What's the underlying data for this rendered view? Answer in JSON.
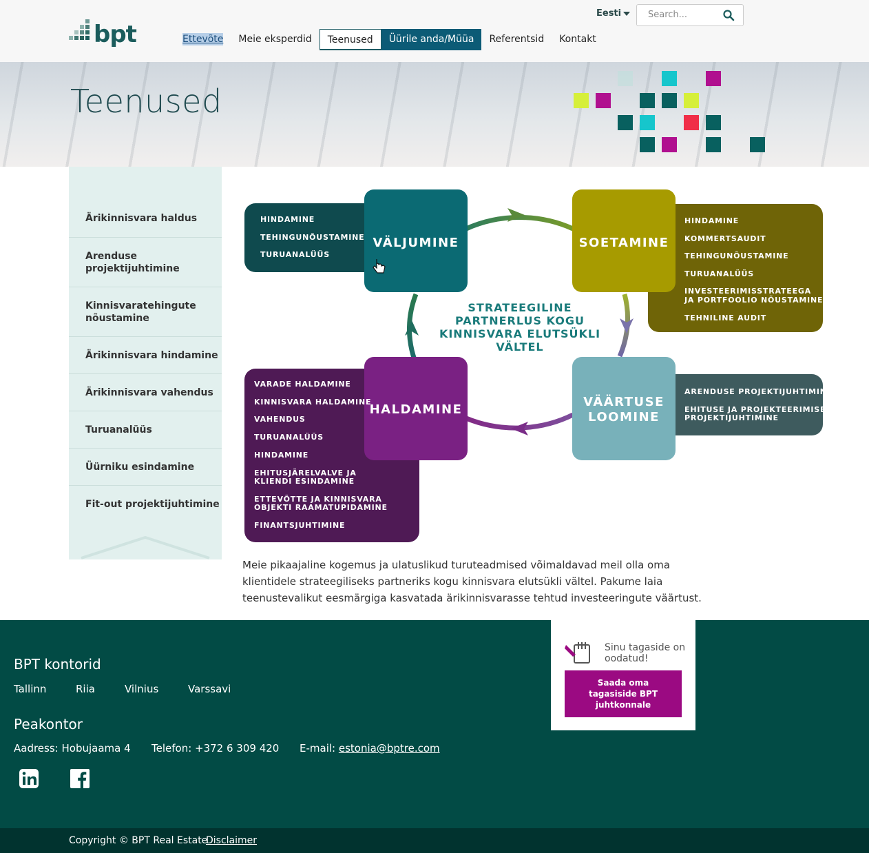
{
  "header": {
    "logo_text": "bpt",
    "lang": "Eesti",
    "search_placeholder": "Search...",
    "nav": [
      "Ettevõte",
      "Meie eksperdid",
      "Teenused",
      "Üürile anda/Müüa",
      "Referentsid",
      "Kontakt"
    ]
  },
  "banner": {
    "title": "Teenused"
  },
  "sidebar": {
    "items": [
      "Ärikinnisvara haldus",
      "Arenduse projektijuhtimine",
      "Kinnisvaratehingute nõustamine",
      "Ärikinnisvara hindamine",
      "Ärikinnisvara vahendus",
      "Turuanalüüs",
      "Üürniku esindamine",
      "Fit-out projektijuhtimine"
    ]
  },
  "diagram": {
    "center": [
      "STRATEEGILINE",
      "PARTNERLUS KOGU",
      "KINNISVARA ELUTSÜKLI",
      "VÄLTEL"
    ],
    "valjumine": {
      "title": "VÄLJUMINE",
      "items": [
        "HINDAMINE",
        "TEHINGUNÕUSTAMINE",
        "TURUANALÜÜS"
      ]
    },
    "soetamine": {
      "title": "SOETAMINE",
      "items": [
        "HINDAMINE",
        "KOMMERTSAUDIT",
        "TEHINGUNÕUSTAMINE",
        "TURUANALÜÜS",
        "INVESTEERIMISSTRATEEGA",
        "JA PORTFOOLIO  NÕUSTAMINE",
        "TEHNILINE AUDIT"
      ]
    },
    "vaartuse": {
      "title": [
        "VÄÄRTUSE",
        "LOOMINE"
      ],
      "items": [
        "ARENDUSE PROJEKTIJUHTIMINE",
        "EHITUSE JA PROJEKTEERIMISE",
        "PROJEKTIJUHTIMINE"
      ]
    },
    "haldamine": {
      "title": "HALDAMINE",
      "items": [
        "VARADE HALDAMINE",
        "KINNISVARA HALDAMINE",
        "VAHENDUS",
        "TURUANALÜÜS",
        "HINDAMINE",
        "EHITUSJÄRELVALVE JA",
        "KLIENDI ESINDAMINE",
        "ETTEVÕTTE JA KINNISVARA",
        "OBJEKTI RAAMATUPIDAMINE",
        "FINANTSJUHTIMINE"
      ]
    }
  },
  "intro": "Meie pikaajaline kogemus ja ulatuslikud turuteadmised võimaldavad meil olla oma klientidele strateegiliseks partneriks kogu kinnisvara elutsükli vältel. Pakume laia teenustevalikut eesmärgiga kasvatada ärikinnisvarasse tehtud investeeringute väärtust.",
  "footer": {
    "offices_title": "BPT kontorid",
    "offices": [
      "Tallinn",
      "Riia",
      "Vilnius",
      "Varssavi"
    ],
    "hq_title": "Peakontor",
    "address": "Aadress: Hobujaama 4",
    "phone": "Telefon: +372 6 309 420",
    "email_label": "E-mail: ",
    "email": "estonia@bptre.com",
    "feedback_text": "Sinu tagaside on oodatud!",
    "feedback_button": "Saada oma tagasiside BPT juhtkonnale",
    "copyright": "Copyright © BPT Real Estate",
    "disclaimer": "Disclaimer"
  },
  "colors": {
    "valjumine": "#0b6a73",
    "valjumine_dark": "#0f4a4e",
    "soetamine": "#a79b00",
    "soetamine_dark": "#6f6407",
    "vaartuse": "#78b1ba",
    "vaartuse_dark": "#3e5b5e",
    "haldamine": "#7a2183",
    "haldamine_dark": "#4f1a55",
    "footer": "#024b45",
    "brand": "#1b5c5c"
  }
}
